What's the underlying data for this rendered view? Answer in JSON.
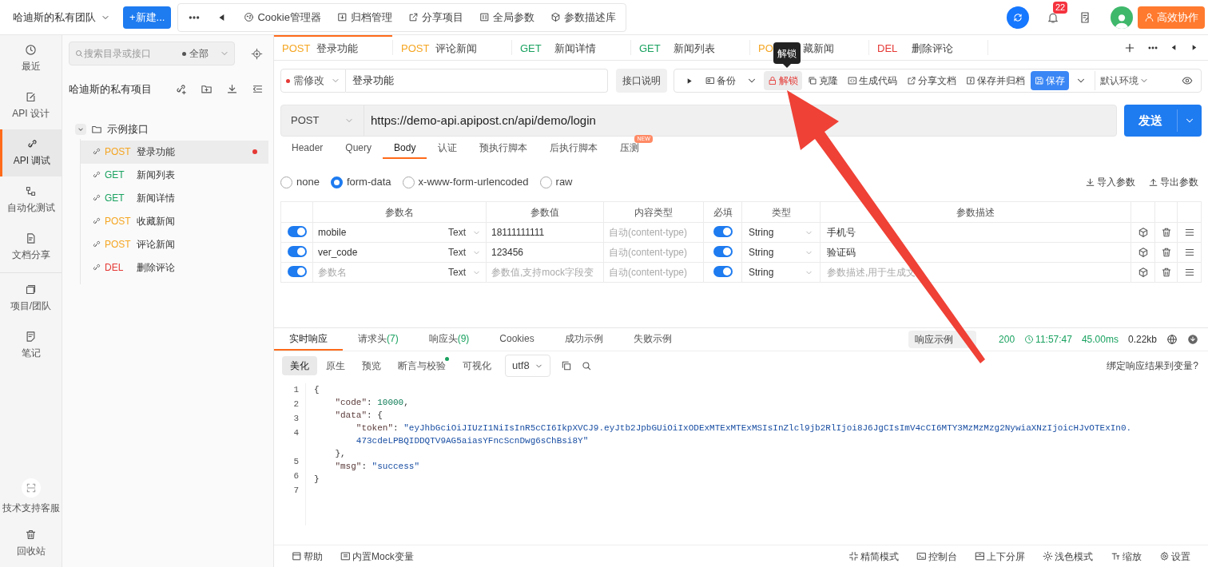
{
  "top_bar": {
    "team": "哈迪斯的私有团队",
    "new_button": "+新建...",
    "tools": [
      "Cookie管理器",
      "归档管理",
      "分享项目",
      "全局参数",
      "参数描述库"
    ],
    "notification_count": "22",
    "collab_button": "高效协作"
  },
  "nav": [
    {
      "label": "最近",
      "selected": false
    },
    {
      "label": "API 设计",
      "selected": false
    },
    {
      "label": "API 调试",
      "selected": true
    },
    {
      "label": "自动化测试",
      "selected": false
    },
    {
      "label": "文档分享",
      "selected": false
    },
    {
      "label": "项目/团队",
      "selected": false
    },
    {
      "label": "笔记",
      "selected": false
    }
  ],
  "nav_bottom": [
    "技术支持客服",
    "回收站"
  ],
  "tree_panel": {
    "search_placeholder": "搜索目录或接口",
    "filter": "全部",
    "project": "哈迪斯的私有项目",
    "folders": [
      {
        "name": "示例接口",
        "expanded": true,
        "children": [
          {
            "method": "POST",
            "color": "#f5a623",
            "name": "登录功能",
            "selected": true,
            "modified": true
          },
          {
            "method": "GET",
            "color": "#1aa260",
            "name": "新闻列表",
            "selected": false,
            "modified": false
          },
          {
            "method": "GET",
            "color": "#1aa260",
            "name": "新闻详情",
            "selected": false,
            "modified": false
          },
          {
            "method": "POST",
            "color": "#f5a623",
            "name": "收藏新闻",
            "selected": false,
            "modified": false
          },
          {
            "method": "POST",
            "color": "#f5a623",
            "name": "评论新闻",
            "selected": false,
            "modified": false
          },
          {
            "method": "DEL",
            "color": "#e53935",
            "name": "删除评论",
            "selected": false,
            "modified": false
          }
        ]
      }
    ]
  },
  "tabs": [
    {
      "method": "POST",
      "color": "#f5a623",
      "name": "登录功能",
      "selected": true
    },
    {
      "method": "POST",
      "color": "#f5a623",
      "name": "评论新闻",
      "selected": false
    },
    {
      "method": "GET",
      "color": "#1aa260",
      "name": "新闻详情",
      "selected": false
    },
    {
      "method": "GET",
      "color": "#1aa260",
      "name": "新闻列表",
      "selected": false
    },
    {
      "method": "PO",
      "color": "#f5a623",
      "name": "藏新闻",
      "selected": false
    },
    {
      "method": "DEL",
      "color": "#e53935",
      "name": "删除评论",
      "selected": false
    }
  ],
  "request": {
    "status": "需修改",
    "name": "登录功能",
    "doc_button": "接口说明",
    "tooltip": "解锁",
    "environment": "默认环境",
    "actions": [
      {
        "label": "备份",
        "kind": "plain",
        "dropdown": true
      },
      {
        "label": "解锁",
        "kind": "hovered",
        "dropdown": false
      },
      {
        "label": "克隆",
        "kind": "plain",
        "dropdown": false
      },
      {
        "label": "生成代码",
        "kind": "plain",
        "dropdown": false
      },
      {
        "label": "分享文档",
        "kind": "plain",
        "dropdown": false
      },
      {
        "label": "保存并归档",
        "kind": "plain",
        "dropdown": false
      },
      {
        "label": "保存",
        "kind": "primary",
        "dropdown": true
      }
    ]
  },
  "url_bar": {
    "method": "POST",
    "url": "https://demo-api.apipost.cn/api/demo/login",
    "send": "发送"
  },
  "request_tabs": [
    {
      "label": "Header",
      "selected": false
    },
    {
      "label": "Query",
      "selected": false
    },
    {
      "label": "Body",
      "selected": true
    },
    {
      "label": "认证",
      "selected": false
    },
    {
      "label": "预执行脚本",
      "selected": false
    },
    {
      "label": "后执行脚本",
      "selected": false
    },
    {
      "label": "压测",
      "selected": false,
      "badge": "NEW"
    }
  ],
  "body_types": [
    {
      "label": "none",
      "selected": false
    },
    {
      "label": "form-data",
      "selected": true
    },
    {
      "label": "x-www-form-urlencoded",
      "selected": false
    },
    {
      "label": "raw",
      "selected": false
    }
  ],
  "param_actions": [
    "导入参数",
    "导出参数"
  ],
  "params": {
    "columns": [
      "参数名",
      "参数值",
      "内容类型",
      "必填",
      "类型",
      "参数描述"
    ],
    "rows": [
      {
        "enabled": true,
        "key": "mobile",
        "value_type": "Text",
        "value": "18111111111",
        "content_type_placeholder": "自动(content-type)",
        "required": true,
        "data_type": "String",
        "description": "手机号"
      },
      {
        "enabled": true,
        "key": "ver_code",
        "value_type": "Text",
        "value": "123456",
        "content_type_placeholder": "自动(content-type)",
        "required": true,
        "data_type": "String",
        "description": "验证码"
      },
      {
        "enabled": true,
        "key_placeholder": "参数名",
        "value_type": "Text",
        "value_placeholder": "参数值,支持mock字段变",
        "content_type_placeholder": "自动(content-type)",
        "required": true,
        "data_type": "String",
        "description_placeholder": "参数描述,用于生成文"
      }
    ]
  },
  "response": {
    "tabs": [
      {
        "label": "实时响应",
        "selected": true
      },
      {
        "label": "请求头",
        "count": "(7)",
        "selected": false
      },
      {
        "label": "响应头",
        "count": "(9)",
        "selected": false
      },
      {
        "label": "Cookies",
        "selected": false
      },
      {
        "label": "成功示例",
        "selected": false
      },
      {
        "label": "失败示例",
        "selected": false
      }
    ],
    "example_button": "响应示例",
    "status": "200",
    "time": "11:57:47",
    "duration": "45.00ms",
    "size": "0.22kb",
    "views": [
      {
        "label": "美化",
        "selected": true,
        "dot": false
      },
      {
        "label": "原生",
        "selected": false,
        "dot": false
      },
      {
        "label": "预览",
        "selected": false,
        "dot": false
      },
      {
        "label": "断言与校验",
        "selected": false,
        "dot": true
      },
      {
        "label": "可视化",
        "selected": false,
        "dot": false
      }
    ],
    "encoding": "utf8",
    "bind_link": "绑定响应结果到变量?",
    "code_lines": [
      {
        "number": "1",
        "parts": [
          {
            "kind": "punct",
            "text": "{"
          }
        ],
        "children": [
          {
            "number": "2",
            "parts": [
              {
                "kind": "key",
                "text": "\"code\""
              },
              {
                "kind": "punct",
                "text": ": "
              },
              {
                "kind": "number",
                "text": "10000"
              },
              {
                "kind": "punct",
                "text": ","
              }
            ]
          },
          {
            "number": "3",
            "parts": [
              {
                "kind": "key",
                "text": "\"data\""
              },
              {
                "kind": "punct",
                "text": ": {"
              }
            ],
            "children": [
              {
                "number": "4",
                "parts": [
                  {
                    "kind": "key",
                    "text": "\"token\""
                  },
                  {
                    "kind": "punct",
                    "text": ": "
                  },
                  {
                    "kind": "string",
                    "text": "\"eyJhbGciOiJIUzI1NiIsInR5cCI6IkpXVCJ9.eyJtb2JpbGUiOiIxODExMTExMTExMSIsInZlcl9jb2RlIjoi8J6JgCIsImV4cCI6MTY3MzMzMzg2NywiaXNzIjoicHJvOTExIn0.473cdeLPBQIDDQTV9AG5aiasYFncScnDwg6sChBsi8Y\""
                  }
                ]
              }
            ]
          },
          {
            "number": "5",
            "parts": [
              {
                "kind": "punct",
                "text": "},"
              }
            ]
          },
          {
            "number": "6",
            "parts": [
              {
                "kind": "key",
                "text": "\"msg\""
              },
              {
                "kind": "punct",
                "text": ": "
              },
              {
                "kind": "string",
                "text": "\"success\""
              }
            ]
          }
        ]
      },
      {
        "number": "7",
        "parts": [
          {
            "kind": "punct",
            "text": "}"
          }
        ]
      }
    ]
  },
  "bottom_bar": {
    "left": [
      "帮助",
      "内置Mock变量"
    ],
    "right": [
      "精简模式",
      "控制台",
      "上下分屏",
      "浅色模式",
      "缩放",
      "设置"
    ]
  }
}
